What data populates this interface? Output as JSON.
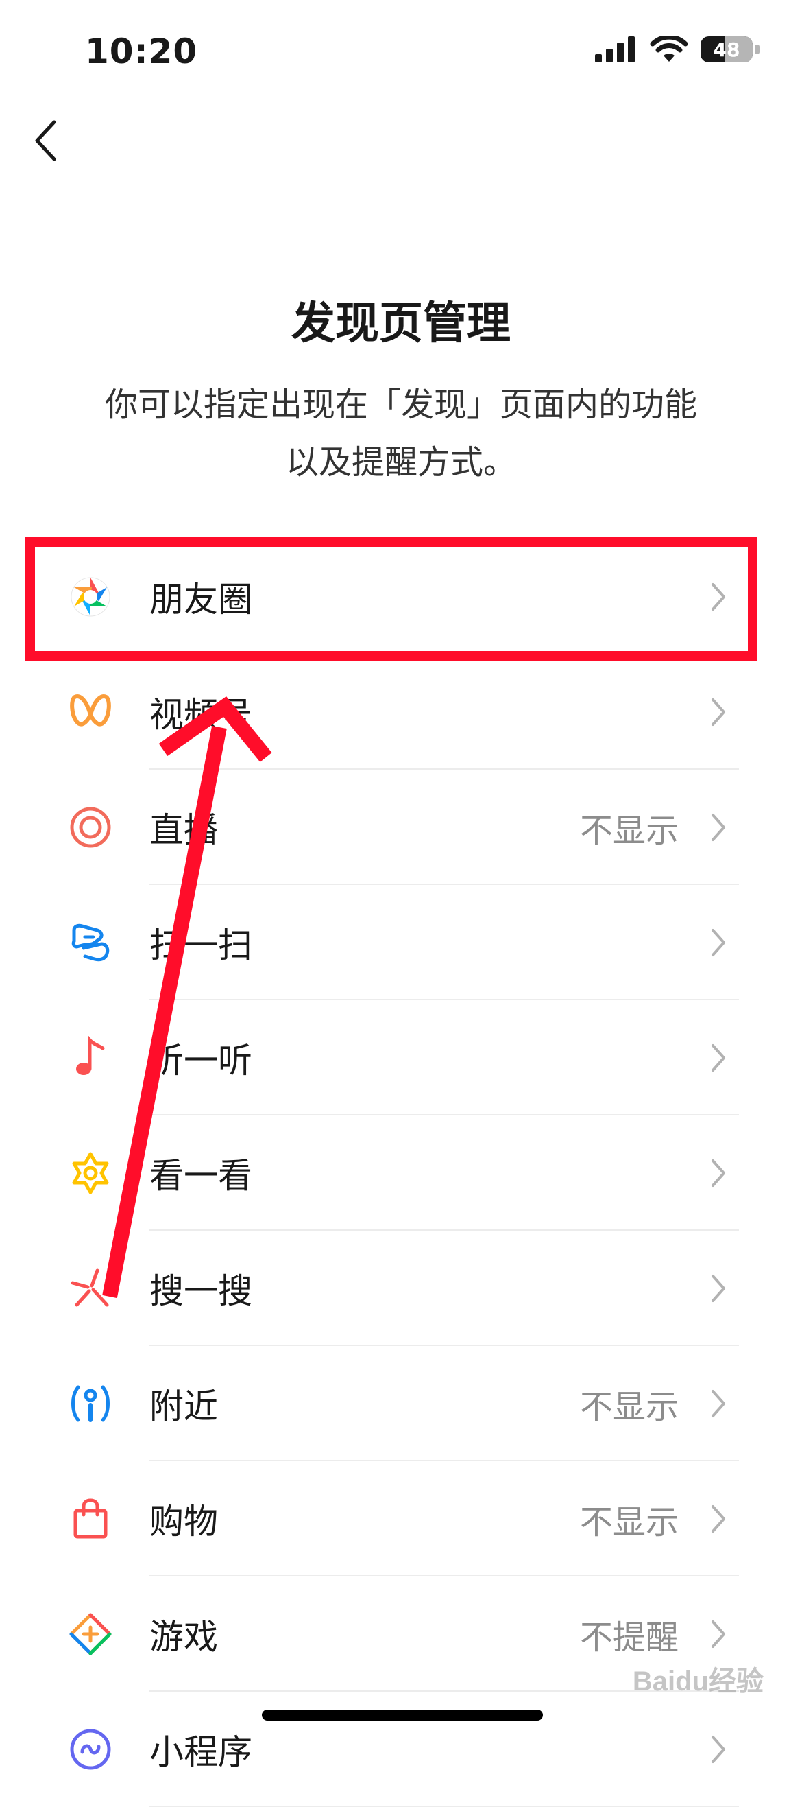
{
  "status_bar": {
    "time": "10:20",
    "battery": "48",
    "battery_level": 0.48
  },
  "header": {
    "back_icon": "chevron-left-icon",
    "title": "发现页管理",
    "description_line1": "你可以指定出现在「发现」页面内的功能",
    "description_line2": "以及提醒方式。"
  },
  "list": {
    "items": [
      {
        "label": "朋友圈",
        "status": "",
        "icon": "moments-aperture-icon",
        "color": "#f5a623"
      },
      {
        "label": "视频号",
        "status": "",
        "icon": "channels-butterfly-icon",
        "color": "#fa9d3b"
      },
      {
        "label": "直播",
        "status": "不显示",
        "icon": "live-ring-icon",
        "color": "#f26b5b"
      },
      {
        "label": "扫一扫",
        "status": "",
        "icon": "scan-icon",
        "color": "#1485ee"
      },
      {
        "label": "听一听",
        "status": "",
        "icon": "music-note-icon",
        "color": "#fa5151"
      },
      {
        "label": "看一看",
        "status": "",
        "icon": "top-stories-star-icon",
        "color": "#ffc300"
      },
      {
        "label": "搜一搜",
        "status": "",
        "icon": "search-sparkle-icon",
        "color": "#fa5151"
      },
      {
        "label": "附近",
        "status": "不显示",
        "icon": "nearby-person-icon",
        "color": "#1485ee"
      },
      {
        "label": "购物",
        "status": "不显示",
        "icon": "shopping-bag-icon",
        "color": "#fa5151"
      },
      {
        "label": "游戏",
        "status": "不提醒",
        "icon": "game-diamond-icon",
        "color": "#fa9d3b"
      },
      {
        "label": "小程序",
        "status": "",
        "icon": "mini-program-icon",
        "color": "#6467f0"
      }
    ]
  },
  "annotation": {
    "highlight_color": "#ff0d2a"
  },
  "watermark": "Baidu经验"
}
